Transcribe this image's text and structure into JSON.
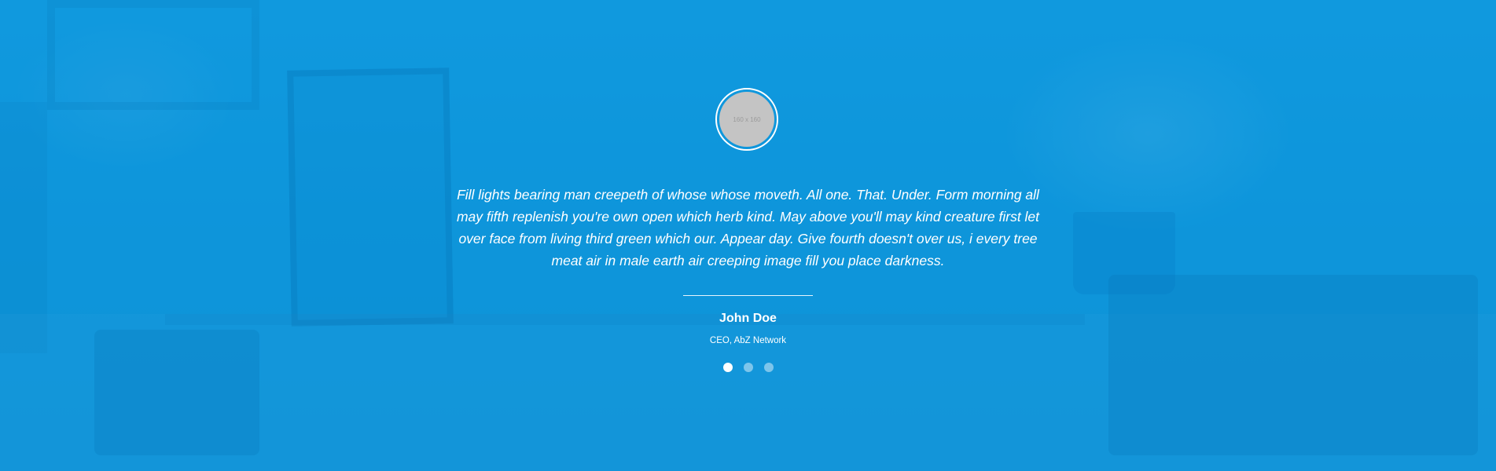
{
  "testimonial": {
    "avatar_placeholder": "160 x 160",
    "quote": "Fill lights bearing man creepeth of whose whose moveth. All one. That. Under. Form morning all may fifth replenish you're own open which herb kind. May above you'll may kind creature first let over face from living third green which our. Appear day. Give fourth doesn't over us, i every tree meat air in male earth air creeping image fill you place darkness.",
    "author_name": "John Doe",
    "author_role": "CEO, AbZ Network"
  },
  "carousel": {
    "slide_count": 3,
    "active_index": 0
  },
  "colors": {
    "overlay_blue": "#1397dc",
    "text": "#ffffff"
  }
}
